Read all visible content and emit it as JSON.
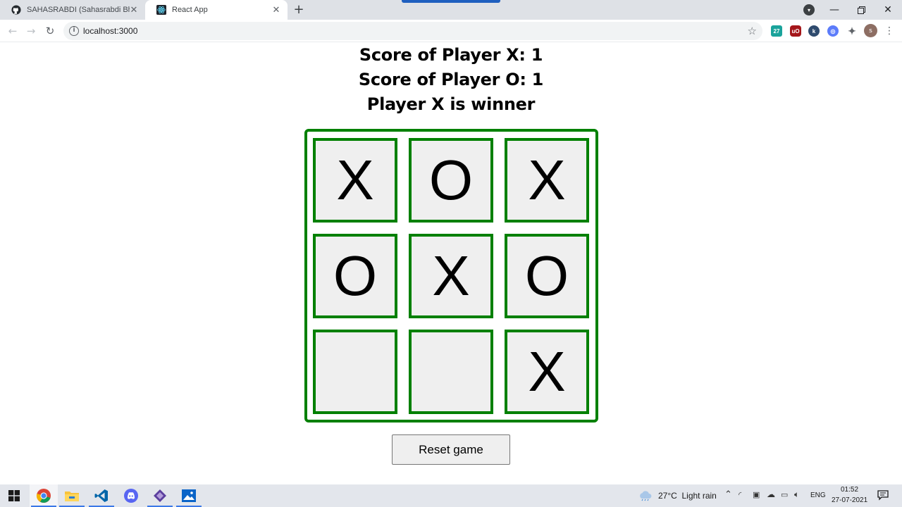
{
  "browser": {
    "tabs": [
      {
        "title": "SAHASRABDI (Sahasrabdi Bhatta",
        "icon": "github-icon",
        "active": false
      },
      {
        "title": "React App",
        "icon": "react-icon",
        "active": true
      }
    ],
    "url": "localhost:3000",
    "profile_initial": "s"
  },
  "game": {
    "score_x": "Score of Player X: 1",
    "score_o": "Score of Player O: 1",
    "status": "Player X is winner",
    "cells": [
      "X",
      "O",
      "X",
      "O",
      "X",
      "O",
      "",
      "",
      "X"
    ],
    "reset_label": "Reset game",
    "border_color": "#008000",
    "cell_bg": "#efefef"
  },
  "taskbar": {
    "weather": "27°C  Light rain",
    "language": "ENG",
    "time": "01:52",
    "date": "27-07-2021"
  }
}
